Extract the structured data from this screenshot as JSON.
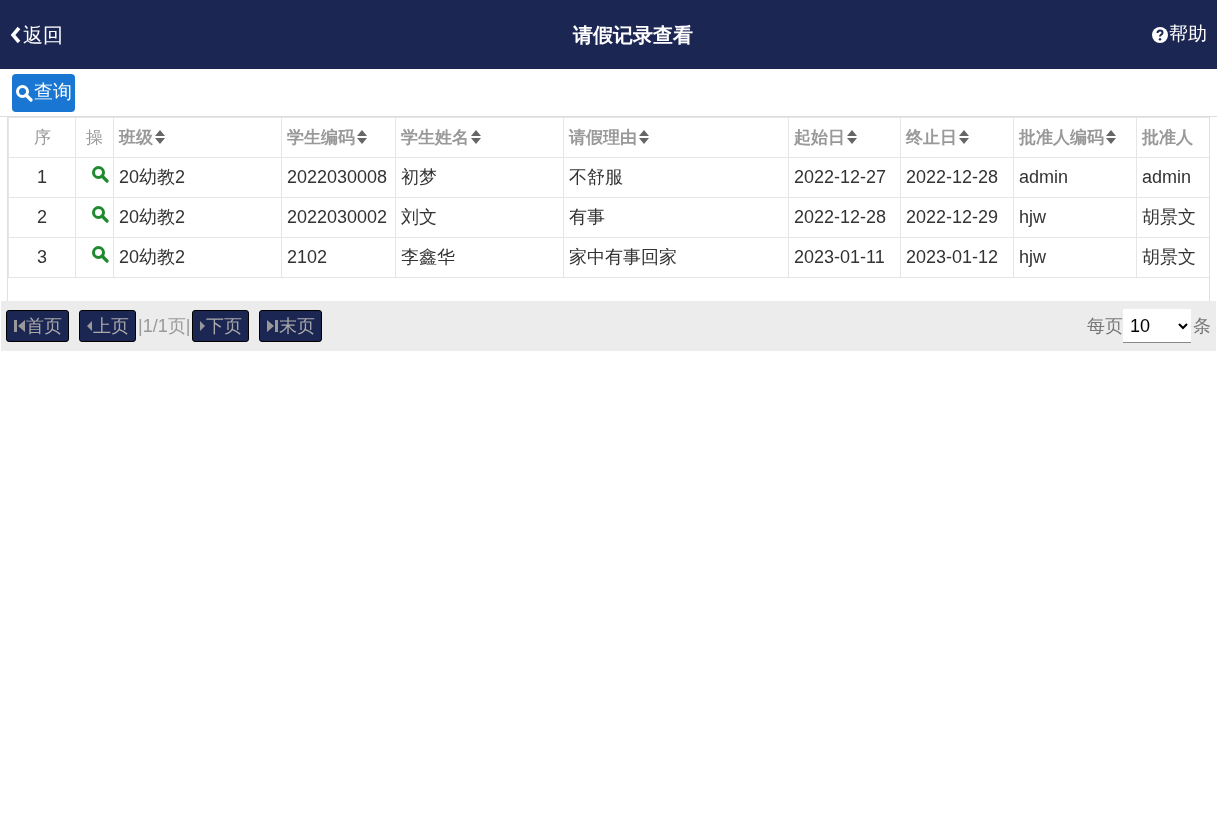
{
  "header": {
    "back": "返回",
    "title": "请假记录查看",
    "help": "帮助"
  },
  "toolbar": {
    "query_button": "查询"
  },
  "table": {
    "columns": [
      {
        "label": "序",
        "sortable": false,
        "kind": "index"
      },
      {
        "label": "操",
        "sortable": false,
        "kind": "action"
      },
      {
        "label": "班级",
        "sortable": true,
        "kind": "text"
      },
      {
        "label": "学生编码",
        "sortable": true,
        "kind": "text"
      },
      {
        "label": "学生姓名",
        "sortable": true,
        "kind": "text"
      },
      {
        "label": "请假理由",
        "sortable": true,
        "kind": "text"
      },
      {
        "label": "起始日",
        "sortable": true,
        "kind": "text"
      },
      {
        "label": "终止日",
        "sortable": true,
        "kind": "text"
      },
      {
        "label": "批准人编码",
        "sortable": true,
        "kind": "text"
      },
      {
        "label": "批准人",
        "sortable": false,
        "kind": "text"
      }
    ],
    "rows": [
      {
        "cells": [
          "1",
          "",
          "20幼教2",
          "2022030008",
          "初梦",
          "不舒服",
          "2022-12-27",
          "2022-12-28",
          "admin",
          "admin"
        ]
      },
      {
        "cells": [
          "2",
          "",
          "20幼教2",
          "2022030002",
          "刘文",
          "有事",
          "2022-12-28",
          "2022-12-29",
          "hjw",
          "胡景文"
        ]
      },
      {
        "cells": [
          "3",
          "",
          "20幼教2",
          "2102",
          "李鑫华",
          "家中有事回家",
          "2023-01-11",
          "2023-01-12",
          "hjw",
          "胡景文"
        ]
      }
    ]
  },
  "pager": {
    "first": "首页",
    "prev": "上页",
    "page_info": "|1/1页|",
    "next": "下页",
    "last": "末页",
    "per_page_label": "每页",
    "per_page": "10",
    "per_page_unit": "条"
  }
}
